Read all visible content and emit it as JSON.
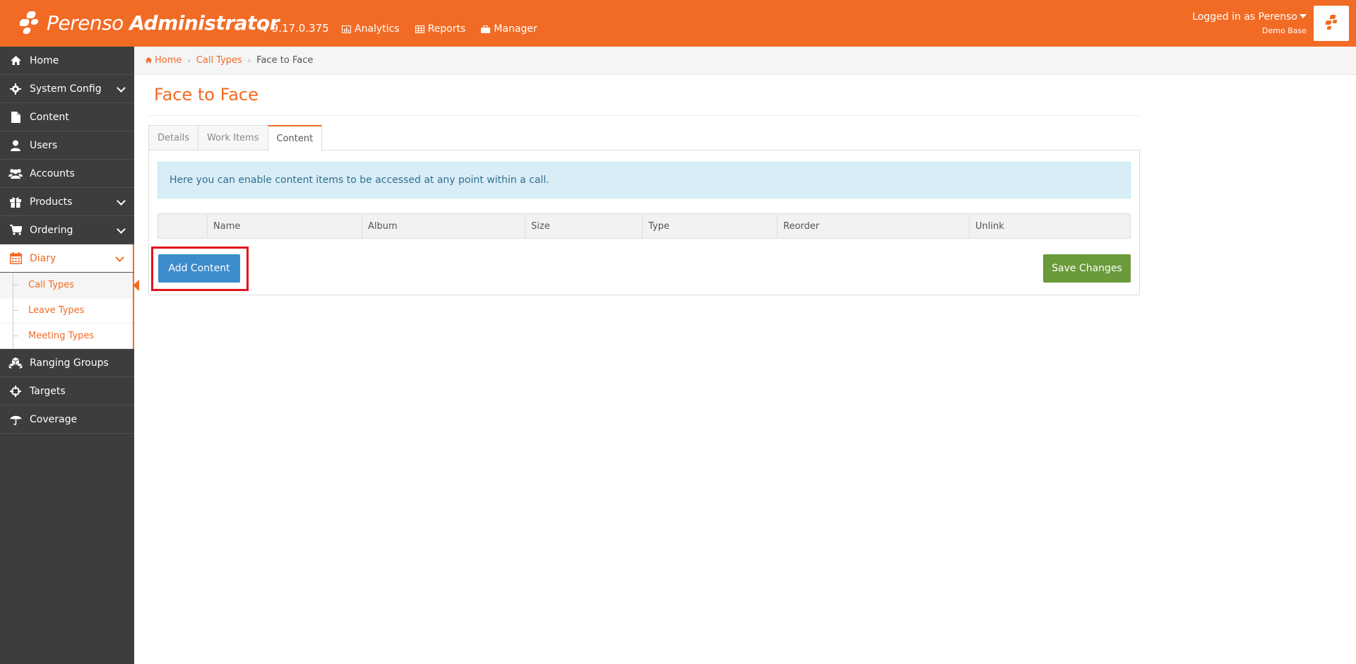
{
  "header": {
    "brand_name": "Perenso",
    "brand_suffix": "Administrator",
    "version": "v 9.17.0.375",
    "nav": [
      {
        "label": "Analytics",
        "icon": "chart-icon"
      },
      {
        "label": "Reports",
        "icon": "table-icon"
      },
      {
        "label": "Manager",
        "icon": "briefcase-icon"
      }
    ],
    "user_label": "Logged in as Perenso",
    "database": "Demo Base"
  },
  "sidebar": {
    "items": [
      {
        "label": "Home",
        "icon": "home-icon",
        "expandable": false
      },
      {
        "label": "System Config",
        "icon": "gear-icon",
        "expandable": true
      },
      {
        "label": "Content",
        "icon": "file-icon",
        "expandable": false
      },
      {
        "label": "Users",
        "icon": "user-icon",
        "expandable": false
      },
      {
        "label": "Accounts",
        "icon": "users-icon",
        "expandable": false
      },
      {
        "label": "Products",
        "icon": "gift-icon",
        "expandable": true
      },
      {
        "label": "Ordering",
        "icon": "cart-icon",
        "expandable": true
      },
      {
        "label": "Diary",
        "icon": "calendar-icon",
        "expandable": true,
        "active": true
      },
      {
        "label": "Ranging Groups",
        "icon": "cubes-icon",
        "expandable": false
      },
      {
        "label": "Targets",
        "icon": "crosshair-icon",
        "expandable": false
      },
      {
        "label": "Coverage",
        "icon": "umbrella-icon",
        "expandable": false
      }
    ],
    "diary_sub": [
      {
        "label": "Call Types",
        "current": true
      },
      {
        "label": "Leave Types"
      },
      {
        "label": "Meeting Types"
      }
    ]
  },
  "breadcrumb": {
    "home": "Home",
    "parent": "Call Types",
    "current": "Face to Face"
  },
  "page": {
    "title": "Face to Face",
    "tabs": [
      {
        "label": "Details"
      },
      {
        "label": "Work Items"
      },
      {
        "label": "Content",
        "active": true
      }
    ],
    "info_text": "Here you can enable content items to be accessed at any point within a call.",
    "table_columns": [
      "",
      "Name",
      "Album",
      "Size",
      "Type",
      "Reorder",
      "Unlink"
    ],
    "add_button": "Add Content",
    "save_button": "Save Changes"
  },
  "colors": {
    "brand_orange": "#f26b25",
    "sidebar_bg": "#3d3d3d",
    "primary_button": "#3d8ccc",
    "success_button": "#6a9a3a",
    "info_bg": "#d9edf7",
    "highlight_red": "#e0141c"
  }
}
